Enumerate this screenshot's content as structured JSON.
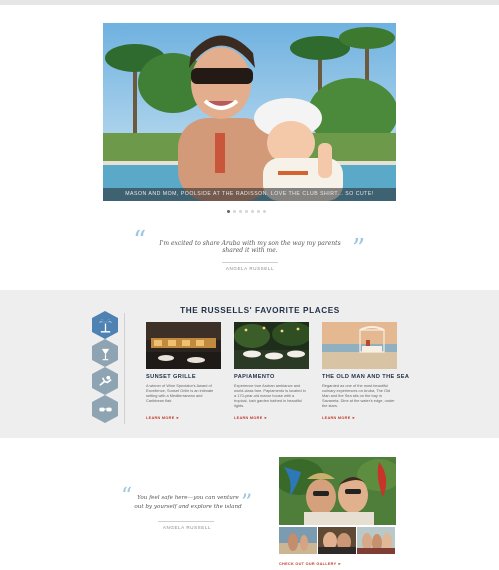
{
  "hero": {
    "caption": "MASON AND MOM, POOLSIDE AT THE RADISSON. LOVE THE CLUB SHIRT... SO CUTE!",
    "slides": 7,
    "active_slide": 1
  },
  "quote_top": {
    "text": "I'm excited to share Aruba with my son the way my parents shared it with me.",
    "author": "ANGELA RUSSELL"
  },
  "favorites": {
    "title": "THE RUSSELLS' FAVORITE PLACES",
    "icons": [
      "palm-tree-icon",
      "cocktail-icon",
      "snorkeler-icon",
      "sunglasses-icon"
    ],
    "cards": [
      {
        "title": "SUNSET GRILLE",
        "description": "A winner of Wine Spectator's Award of Excellence, Sunset Grille is an intimate setting with a Mediterranean and Caribbean flair.",
        "link": "LEARN MORE ►"
      },
      {
        "title": "PAPIAMENTO",
        "description": "Experience true Aruban ambiance and world-class fare. Papiamento is located in a 170-year-old manor house with a tropical, lush garden bathed in beautiful lights.",
        "link": "LEARN MORE ►"
      },
      {
        "title": "THE OLD MAN AND THE SEA",
        "description": "Regarded as one of the most beautiful culinary experiences on Aruba, The Old Man and the Sea sits on the bay in Savaneta. Dine at the water's edge, under the stars.",
        "link": "LEARN MORE ►"
      }
    ]
  },
  "quote_bottom": {
    "text": "You feel safe here—you can venture out by yourself and explore the island",
    "author": "ANGELA RUSSELL"
  },
  "gallery": {
    "link": "CHECK OUT OUR GALLERY ►"
  },
  "colors": {
    "accent_quote": "#9cc9de",
    "heading": "#1e2f45",
    "link_red": "#c0392b",
    "hex_blue": "#4d82b3",
    "hex_gray": "#8fa4b3"
  }
}
